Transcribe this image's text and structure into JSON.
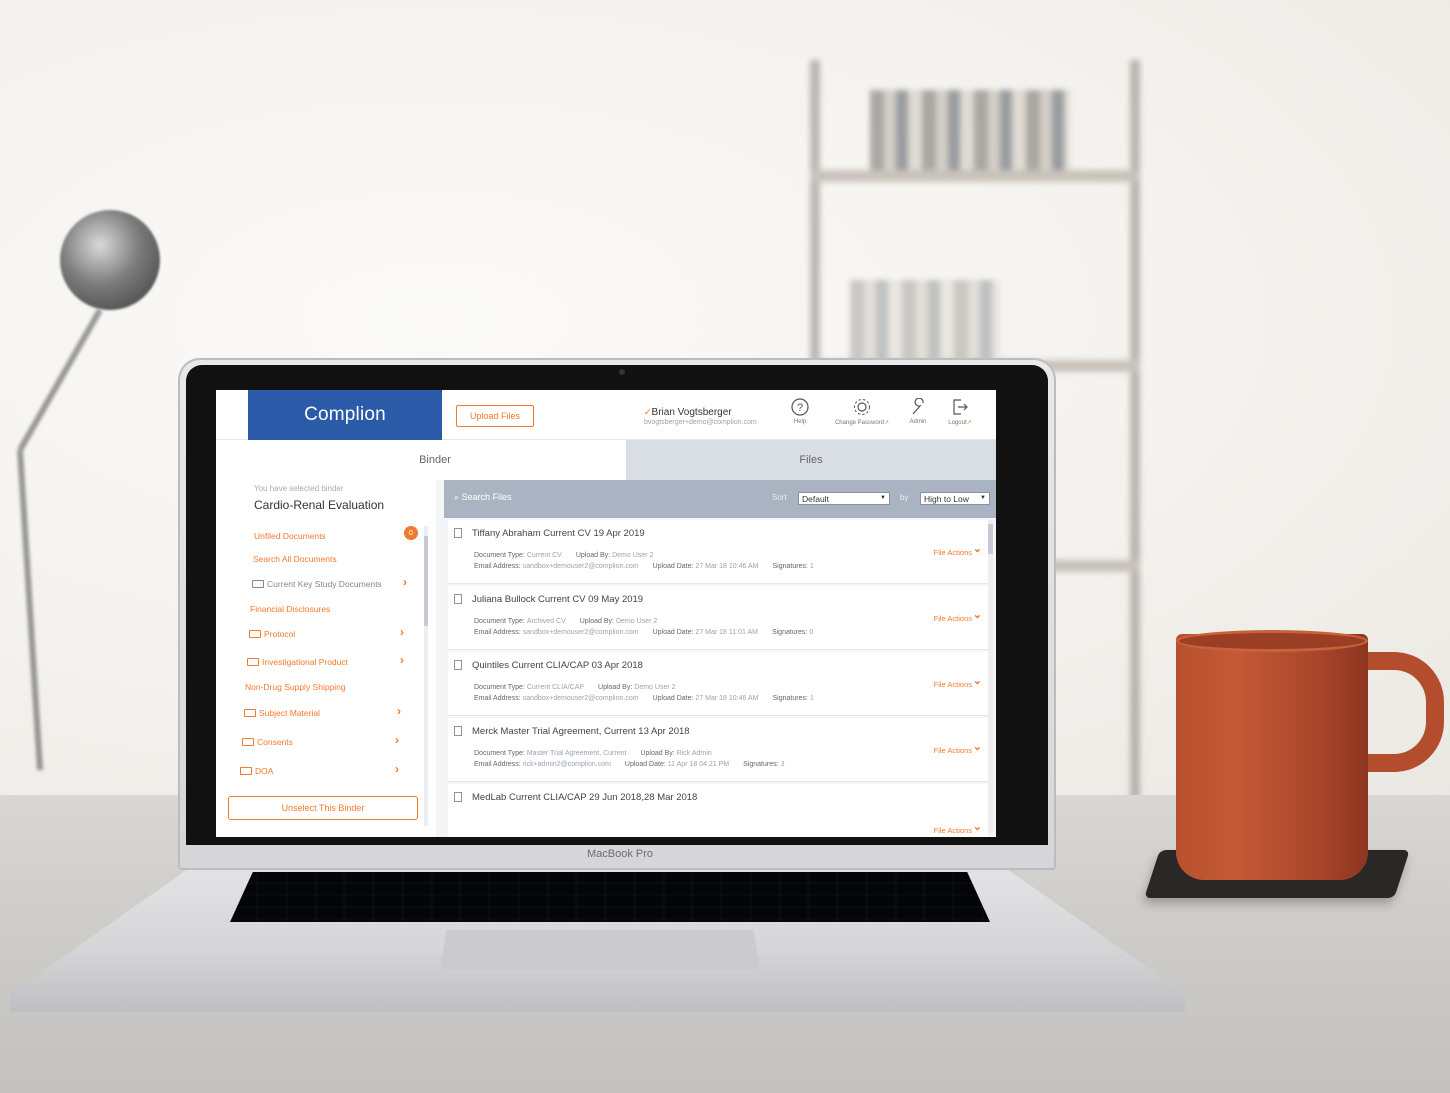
{
  "device": {
    "brand_label": "MacBook Pro"
  },
  "app": {
    "logo": "Complion",
    "upload_button": "Upload Files",
    "user": {
      "name": "Brian Vogtsberger",
      "email": "bvogtsberger+demo@complion.com"
    },
    "toolbar": [
      {
        "label": "Help",
        "icon": "help-icon"
      },
      {
        "label": "Change Password",
        "icon": "gear-icon"
      },
      {
        "label": "Admin",
        "icon": "wrench-icon"
      },
      {
        "label": "Logout",
        "icon": "logout-icon"
      }
    ],
    "tabs": {
      "binder": "Binder",
      "files": "Files"
    },
    "sidebar": {
      "selected_label": "You have selected binder",
      "binder_name": "Cardio-Renal Evaluation",
      "unfiled_count": "0",
      "items": [
        "Unfiled Documents",
        "Search All Documents",
        "Current Key Study Documents",
        "Financial Disclosures",
        "Protocol",
        "Investigational Product",
        "Non-Drug Supply Shipping",
        "Subject Material",
        "Consents",
        "DOA"
      ],
      "unselect_button": "Unselect This Binder"
    },
    "filebar": {
      "search_placeholder": "Search Files",
      "sort_label": "Sort",
      "sort_value": "Default",
      "by_label": "by",
      "order_value": "High to Low"
    },
    "field_labels": {
      "doc_type": "Document Type:",
      "upload_by": "Upload By:",
      "email": "Email Address:",
      "upload_date": "Upload Date:",
      "signatures": "Signatures:",
      "file_actions": "File Actions"
    },
    "documents": [
      {
        "title": "Tiffany Abraham Current CV 19 Apr 2019",
        "doc_type": "Current CV",
        "upload_by": "Demo User 2",
        "email": "sandbox+demouser2@complion.com",
        "upload_date": "27 Mar 18 10:46 AM",
        "signatures": "1"
      },
      {
        "title": "Juliana Bullock Current CV 09 May 2019",
        "doc_type": "Archived CV",
        "upload_by": "Demo User 2",
        "email": "sandbox+demouser2@complion.com",
        "upload_date": "27 Mar 18 11:01 AM",
        "signatures": "0"
      },
      {
        "title": "Quintiles Current CLIA/CAP 03 Apr 2018",
        "doc_type": "Current CLIA/CAP",
        "upload_by": "Demo User 2",
        "email": "sandbox+demouser2@complion.com",
        "upload_date": "27 Mar 18 10:46 AM",
        "signatures": "1"
      },
      {
        "title": "Merck Master Trial Agreement, Current 13 Apr 2018",
        "doc_type": "Master Trial Agreement, Current",
        "upload_by": "Rick Admin",
        "email": "rick+admin2@complion.com",
        "upload_date": "11 Apr 18 04:21 PM",
        "signatures": "3"
      },
      {
        "title": "MedLab Current CLIA/CAP 29 Jun 2018,28 Mar 2018"
      }
    ]
  }
}
